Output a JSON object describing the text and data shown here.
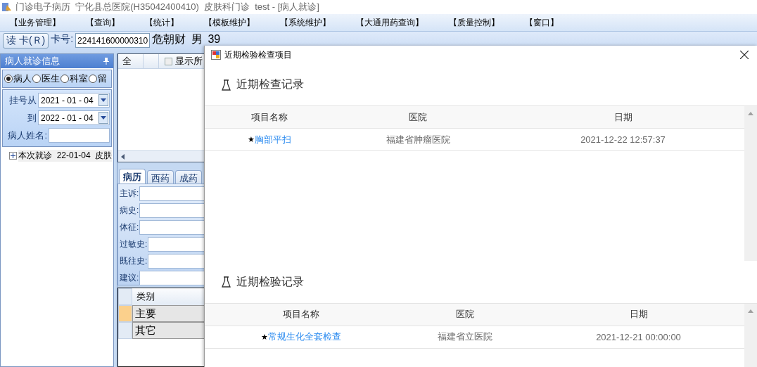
{
  "window": {
    "title": "门诊电子病历  宁化县总医院(H35042400410)  皮肤科门诊  test - [病人就诊]"
  },
  "menu": [
    "【业务管理】",
    "【查询】",
    "【统计】",
    "【模板维护】",
    "【系统维护】",
    "【大通用药查询】",
    "【质量控制】",
    "【窗口】"
  ],
  "toolbar": {
    "read_card_button": "读 卡(Ｒ)",
    "card_label": "卡号:",
    "card_number": "224141600000310",
    "patient_info": "危朝财  男  39"
  },
  "left_panel": {
    "title": "病人就诊信息",
    "radios": [
      {
        "label": "病人",
        "selected": true
      },
      {
        "label": "医生",
        "selected": false
      },
      {
        "label": "科室",
        "selected": false
      },
      {
        "label": "留",
        "selected": false
      }
    ],
    "date_from_label": "挂号从",
    "date_from": "2021 - 01 - 04",
    "date_to_label": "到",
    "date_to": "2022 - 01 - 04",
    "name_label": "病人姓名:",
    "tree": [
      {
        "label": "本次就诊  22-01-04  皮肤",
        "expanded": false
      }
    ]
  },
  "middle_panel": {
    "grid_header": "全",
    "show_all": {
      "label": "显示所",
      "checked": false
    },
    "tabs": [
      {
        "label": "病历",
        "selected": true
      },
      {
        "label": "西药",
        "selected": false
      },
      {
        "label": "成药",
        "selected": false
      }
    ],
    "fields": [
      "主诉:",
      "病史:",
      "体征:",
      "过敏史:",
      "既往史:",
      "建议:"
    ],
    "diagnosis_header": "类别",
    "diagnosis_rows": [
      {
        "value": "主要",
        "selected": true
      },
      {
        "value": "其它",
        "selected": false
      }
    ]
  },
  "dialog": {
    "title": "近期检验检查项目",
    "sections": [
      {
        "title": "近期检查记录",
        "columns": [
          "项目名称",
          "医院",
          "日期"
        ],
        "rows": [
          {
            "mark": "★",
            "name": "胸部平扫",
            "hospital": "福建省肿瘤医院",
            "date": "2021-12-22 12:57:37"
          }
        ]
      },
      {
        "title": "近期检验记录",
        "columns": [
          "项目名称",
          "医院",
          "日期"
        ],
        "rows": [
          {
            "mark": "★",
            "name": "常规生化全套检查",
            "hospital": "福建省立医院",
            "date": "2021-12-21 00:00:00"
          }
        ]
      }
    ]
  }
}
